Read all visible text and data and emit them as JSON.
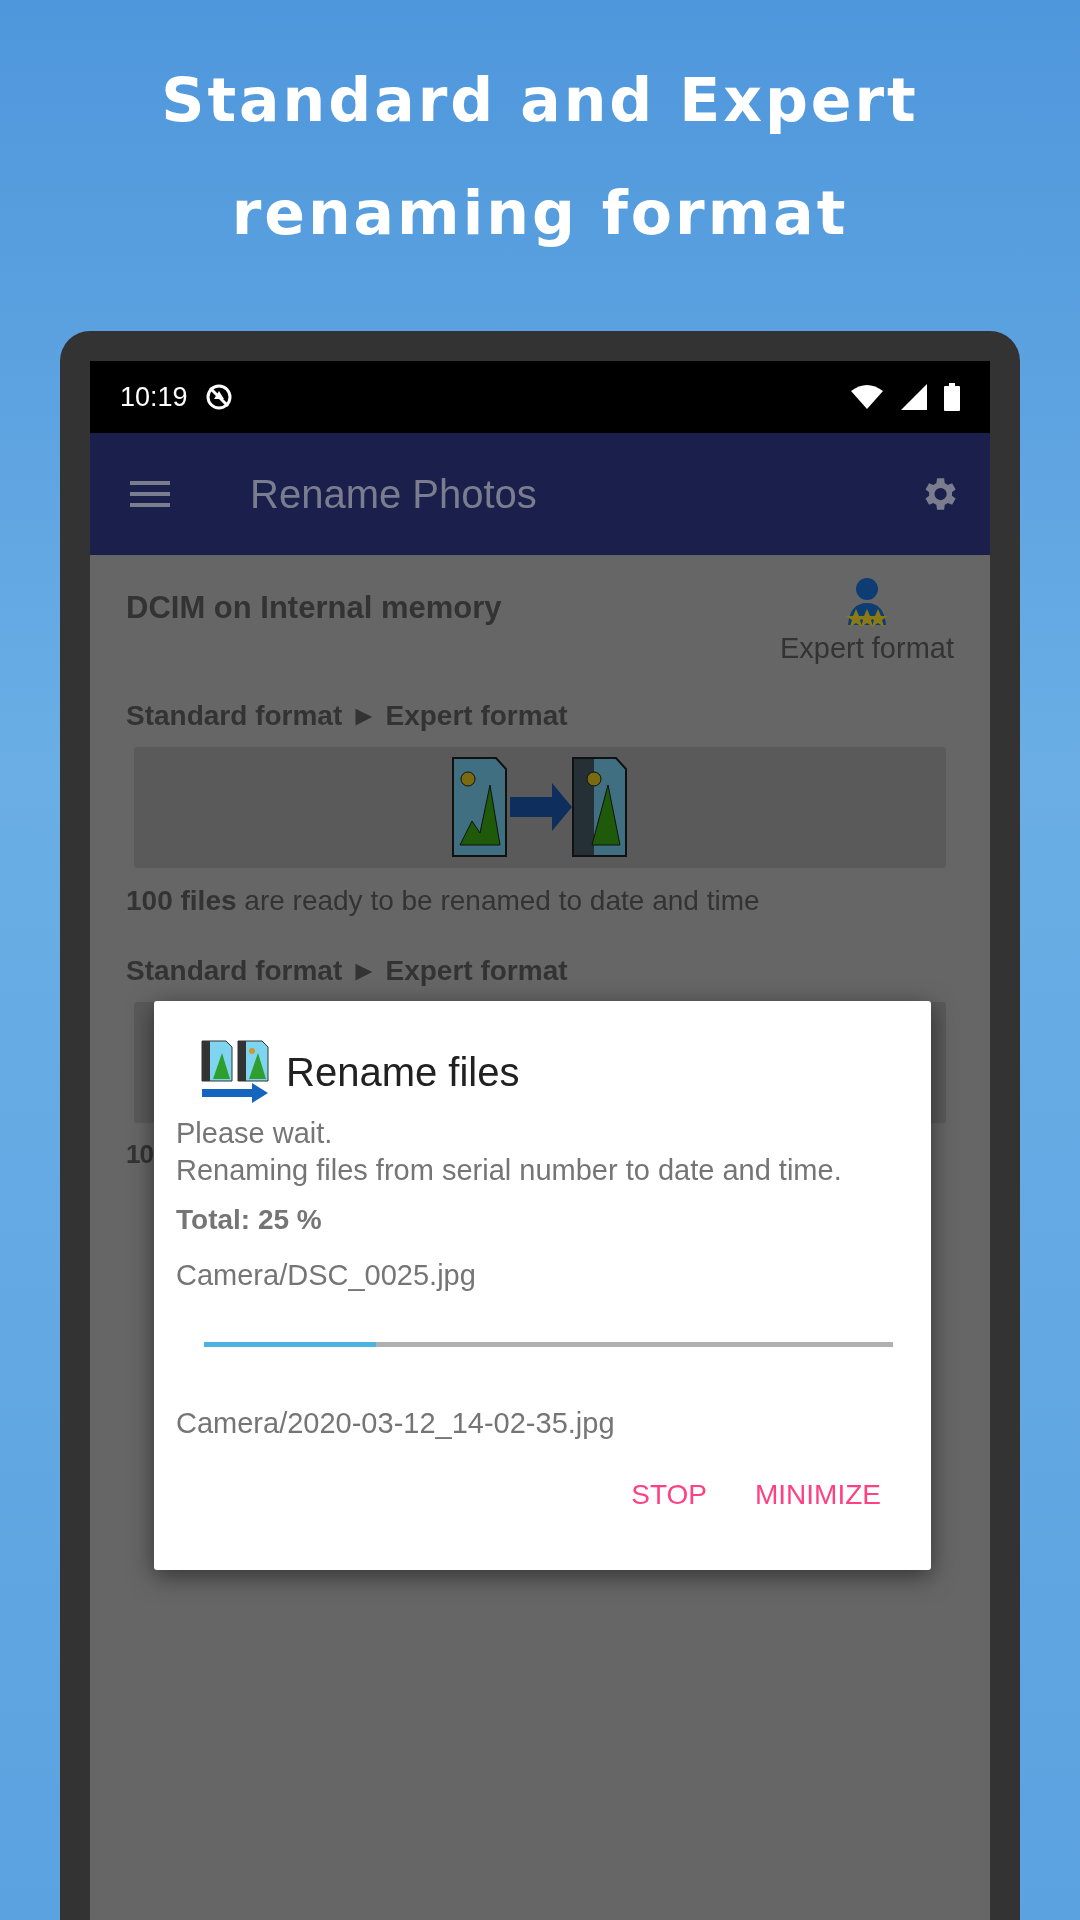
{
  "headline": [
    "Standard and Expert",
    "renaming format"
  ],
  "status_bar": {
    "time": "10:19"
  },
  "app_bar": {
    "title": "Rename Photos"
  },
  "folder": {
    "title": "DCIM on Internal memory",
    "mode_label": "Expert format"
  },
  "sections": [
    {
      "heading": "Standard format ► Expert format",
      "count": "100 files",
      "summary": "are ready to be renamed to date and time"
    },
    {
      "heading": "Standard format ► Expert format",
      "count": "10"
    }
  ],
  "dialog": {
    "title": "Rename files",
    "message": [
      "Please wait.",
      "Renaming files from serial number to date and time."
    ],
    "total": "Total: 25 %",
    "current_file": "Camera/DSC_0025.jpg",
    "progress": {
      "level": 0.25
    },
    "new_file": "Camera/2020-03-12_14-02-35.jpg",
    "buttons": [
      "STOP",
      "MINIMIZE"
    ]
  }
}
